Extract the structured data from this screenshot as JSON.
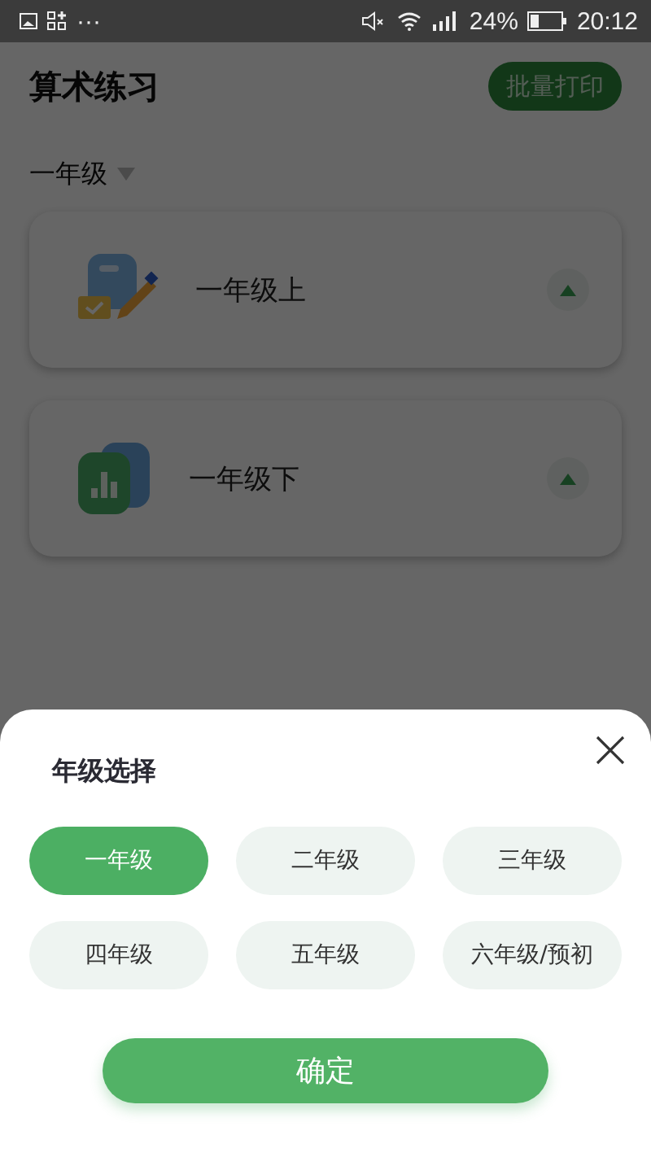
{
  "status_bar": {
    "more": "···",
    "battery": "24%",
    "time": "20:12"
  },
  "header": {
    "title": "算术练习",
    "action": "批量打印"
  },
  "grade_filter": {
    "label": "一年级"
  },
  "cards": [
    {
      "title": "一年级上",
      "kind": "notebook"
    },
    {
      "title": "一年级下",
      "kind": "chart"
    }
  ],
  "sheet": {
    "title": "年级选择",
    "options": [
      {
        "label": "一年级",
        "selected": true
      },
      {
        "label": "二年级",
        "selected": false
      },
      {
        "label": "三年级",
        "selected": false
      },
      {
        "label": "四年级",
        "selected": false
      },
      {
        "label": "五年级",
        "selected": false
      },
      {
        "label": "六年级/预初",
        "selected": false
      }
    ],
    "confirm": "确定"
  }
}
